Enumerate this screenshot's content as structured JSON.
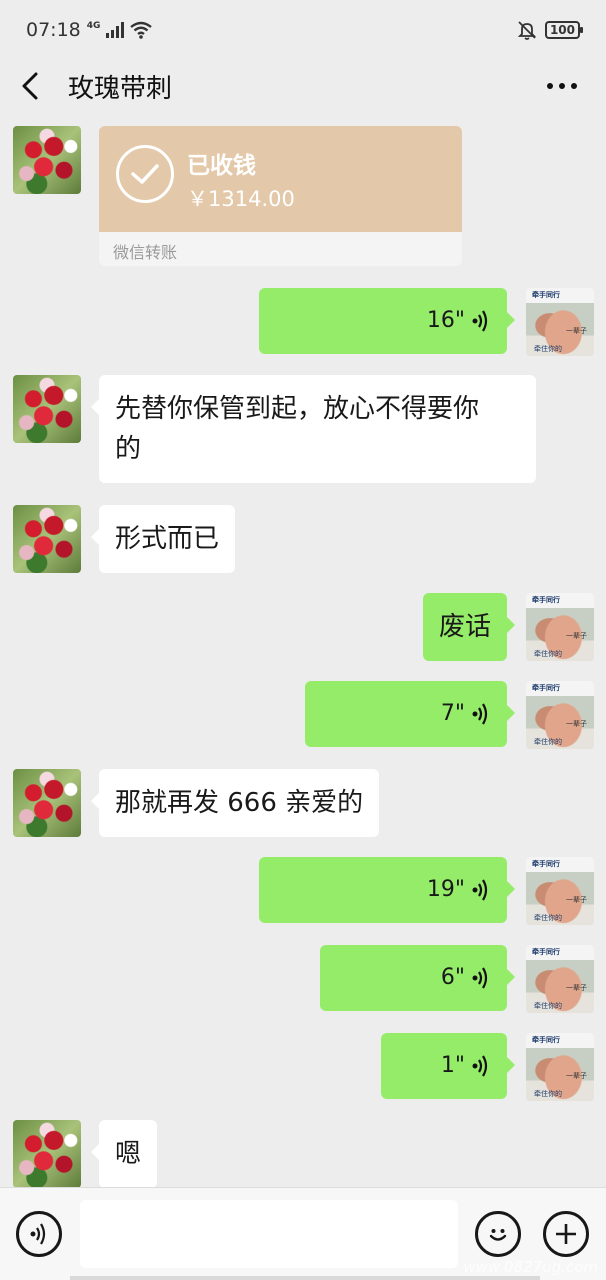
{
  "status_bar": {
    "time": "07:18",
    "network": "4G",
    "battery": "100"
  },
  "header": {
    "title": "玫瑰带刺"
  },
  "transfer": {
    "status": "已收钱",
    "amount": "￥1314.00",
    "footer": "微信转账"
  },
  "messages": [
    {
      "type": "voice",
      "from": "me",
      "duration": "16\""
    },
    {
      "type": "text",
      "from": "other",
      "lines": [
        "先替你保管到起，放心不得要你",
        "的"
      ]
    },
    {
      "type": "text",
      "from": "other",
      "text": "形式而已"
    },
    {
      "type": "text",
      "from": "me",
      "text": "废话"
    },
    {
      "type": "voice",
      "from": "me",
      "duration": "7\""
    },
    {
      "type": "text",
      "from": "other",
      "text": "那就再发 666 亲爱的"
    },
    {
      "type": "voice",
      "from": "me",
      "duration": "19\""
    },
    {
      "type": "voice",
      "from": "me",
      "duration": "6\""
    },
    {
      "type": "voice",
      "from": "me",
      "duration": "1\""
    },
    {
      "type": "text",
      "from": "other",
      "text": "嗯"
    }
  ],
  "my_avatar_caption": {
    "top": "牵手同行",
    "mid": "一辈子",
    "bottom": "牵住你的"
  },
  "input": {
    "placeholder": ""
  },
  "watermark": "www.0827ug.com",
  "colors": {
    "my_bubble": "#95ec69",
    "other_bubble": "#ffffff",
    "transfer": "#e3c9a9",
    "background": "#ededed"
  }
}
